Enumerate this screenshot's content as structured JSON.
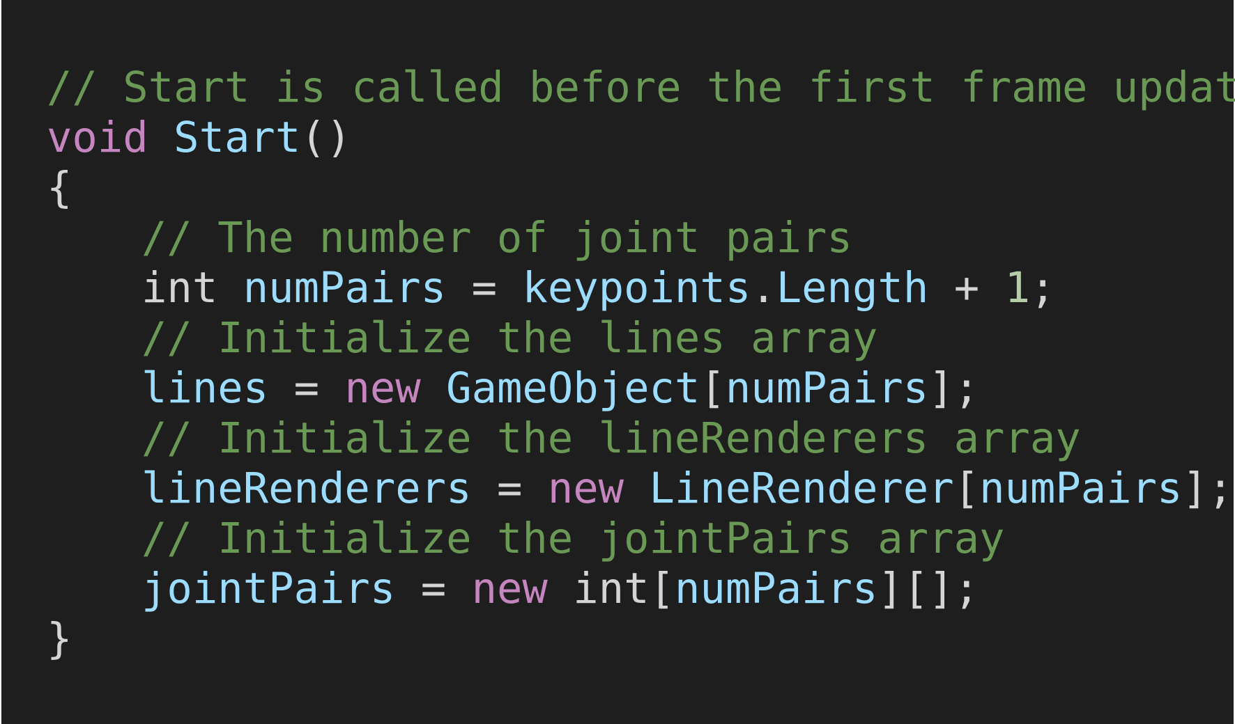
{
  "colors": {
    "background": "#1e1e1e",
    "comment": "#6a9955",
    "keyword": "#c586c0",
    "identifier": "#9cdcfe",
    "plain": "#d4d4d4",
    "number": "#b5cea8"
  },
  "lines": [
    {
      "comment": "// Start is called before the first frame update"
    },
    {
      "keyword": "void",
      "name": "Start",
      "parens": "()"
    },
    {
      "brace": "{"
    },
    {
      "comment": "// The number of joint pairs"
    },
    {
      "type": "int",
      "var": "numPairs",
      "eq": "=",
      "obj": "keypoints",
      "dot": ".",
      "prop": "Length",
      "op": "+",
      "num": "1",
      "semi": ";"
    },
    {
      "comment": "// Initialize the lines array"
    },
    {
      "var": "lines",
      "eq": "=",
      "keyword": "new",
      "type": "GameObject",
      "lb": "[",
      "arg": "numPairs",
      "rb": "];"
    },
    {
      "comment": "// Initialize the lineRenderers array"
    },
    {
      "var": "lineRenderers",
      "eq": "=",
      "keyword": "new",
      "type": "LineRenderer",
      "lb": "[",
      "arg": "numPairs",
      "rb": "];"
    },
    {
      "comment": "// Initialize the jointPairs array"
    },
    {
      "var": "jointPairs",
      "eq": "=",
      "keyword": "new",
      "type": "int",
      "lb": "[",
      "arg": "numPairs",
      "rb": "][];"
    },
    {
      "brace": "}"
    }
  ]
}
